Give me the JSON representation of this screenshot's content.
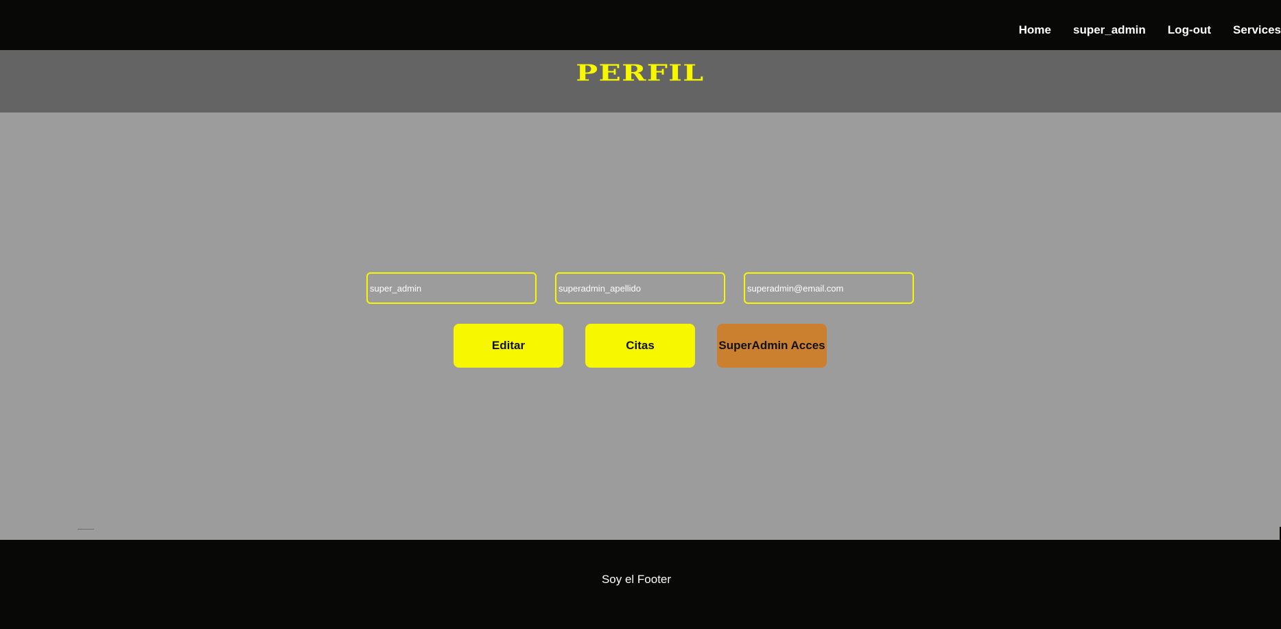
{
  "nav": {
    "items": [
      {
        "label": "Home"
      },
      {
        "label": "super_admin"
      },
      {
        "label": "Log-out"
      },
      {
        "label": "Services"
      }
    ]
  },
  "header": {
    "title": "PERFIL"
  },
  "profile": {
    "name": "super_admin",
    "surname": "superadmin_apellido",
    "email": "superadmin@email.com"
  },
  "actions": {
    "edit_label": "Editar",
    "appointments_label": "Citas",
    "superadmin_label": "SuperAdmin Acces"
  },
  "footer": {
    "text": "Soy el Footer"
  },
  "colors": {
    "navbar_bg": "#080806",
    "title_band_bg": "#646464",
    "main_bg": "#9c9c9c",
    "accent_yellow": "#f7f700",
    "accent_orange": "#cb8030"
  }
}
